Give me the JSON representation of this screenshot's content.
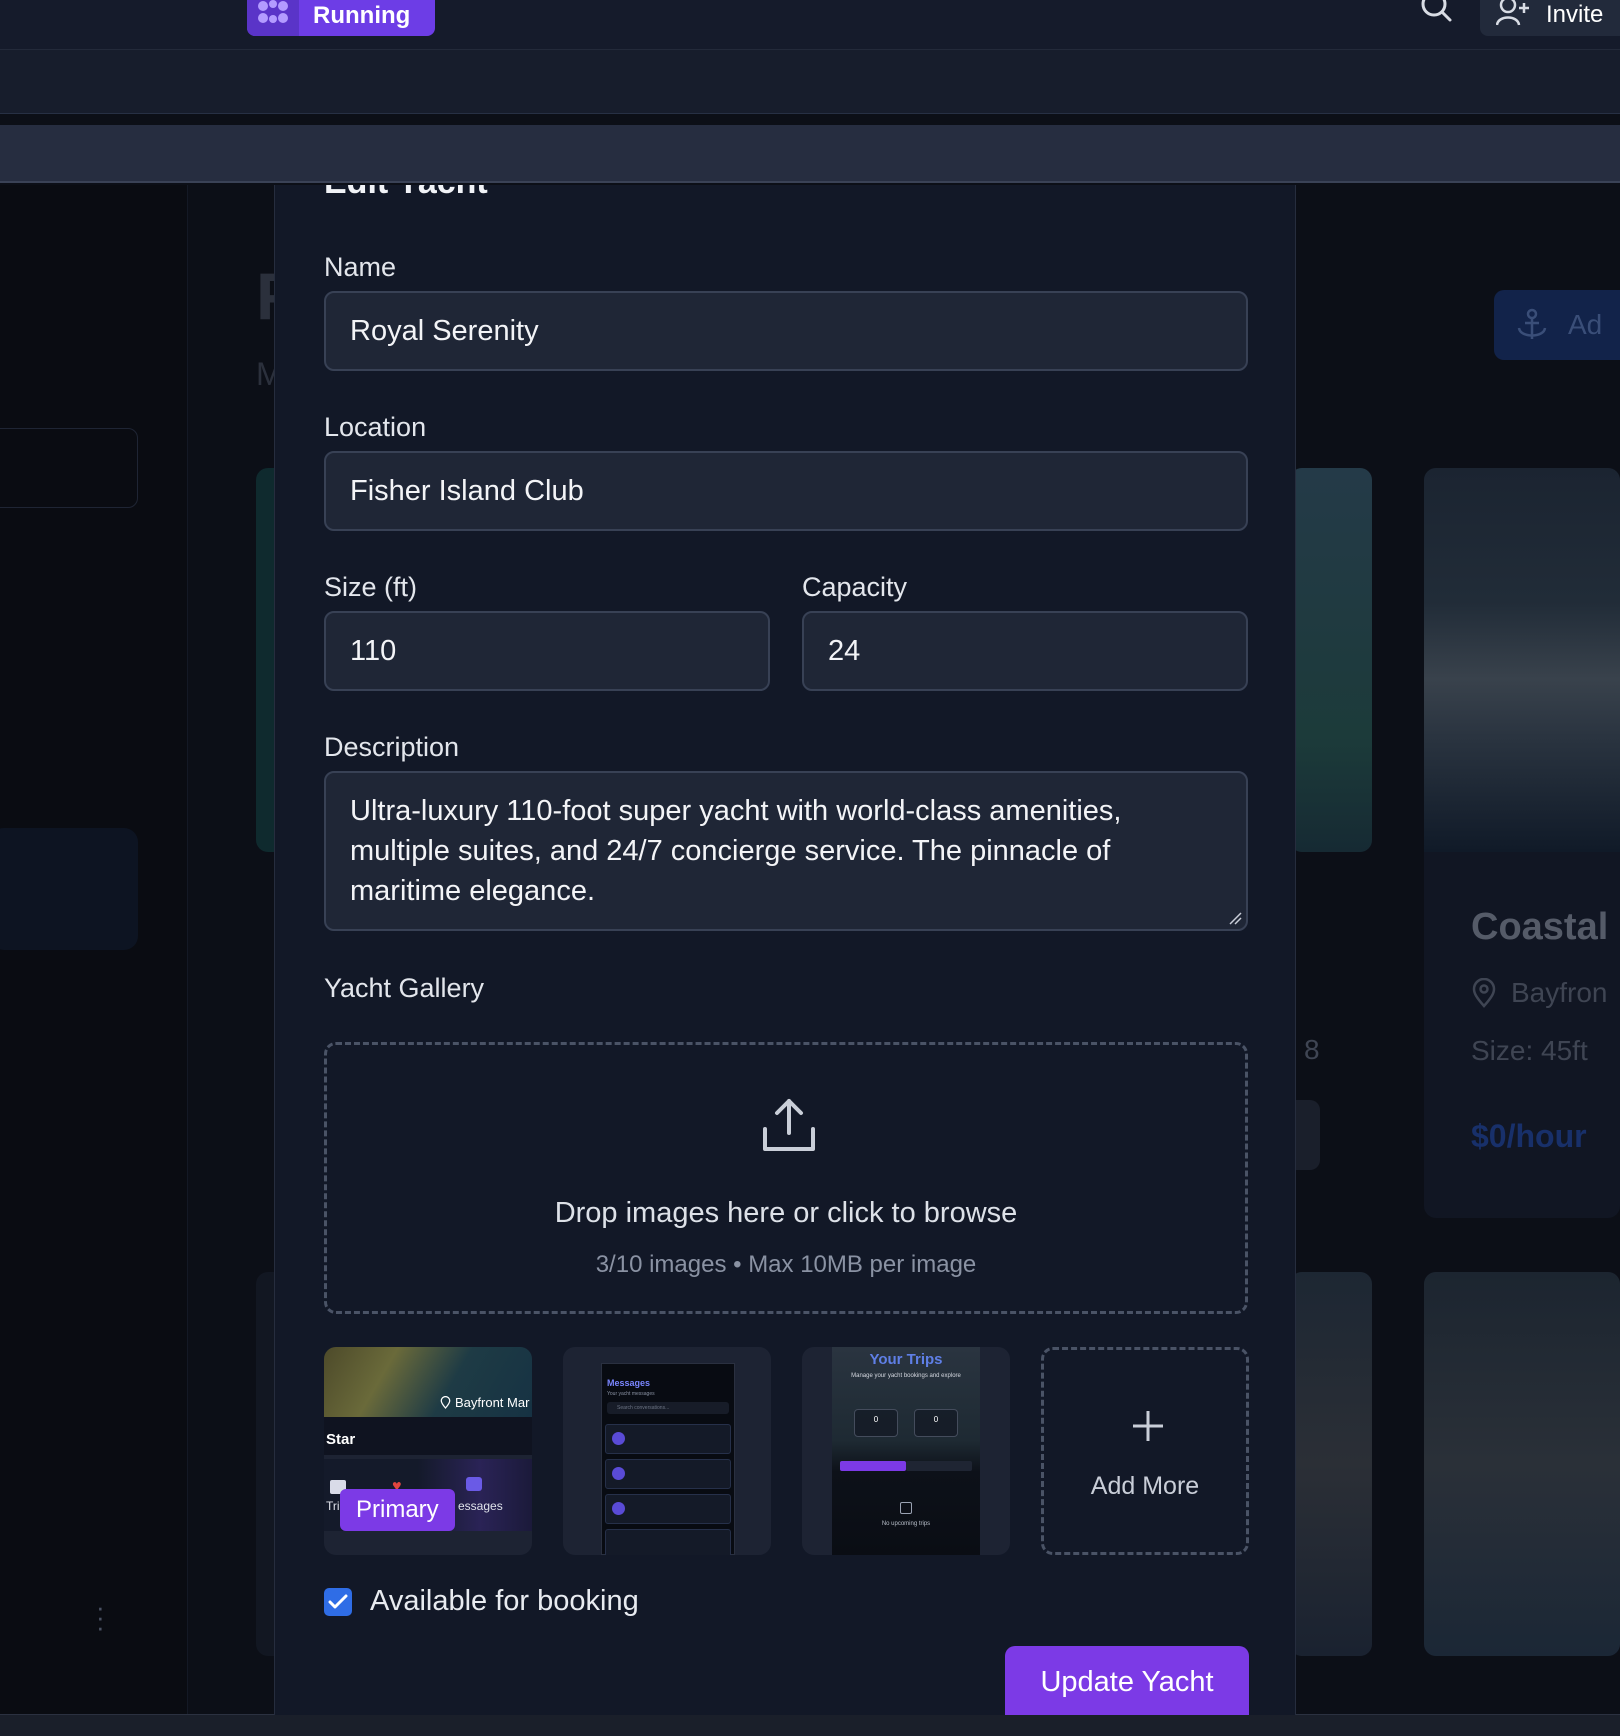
{
  "topbar": {
    "status_label": "Running",
    "invite_label": "Invite"
  },
  "background": {
    "page_title_initial": "F",
    "subtitle_initial": "M",
    "add_button_label": "Ad",
    "card": {
      "title": "Coastal",
      "location": "Bayfron",
      "size": "Size: 45ft",
      "price": "$0/hour"
    },
    "other_card_number": "8"
  },
  "modal": {
    "title": "Edit Yacht",
    "name": {
      "label": "Name",
      "value": "Royal Serenity"
    },
    "location": {
      "label": "Location",
      "value": "Fisher Island Club"
    },
    "size": {
      "label": "Size (ft)",
      "value": "110"
    },
    "capacity": {
      "label": "Capacity",
      "value": "24"
    },
    "description": {
      "label": "Description",
      "value": "Ultra-luxury 110-foot super yacht with world-class amenities, multiple suites, and 24/7 concierge service. The pinnacle of maritime elegance."
    },
    "gallery": {
      "label": "Yacht Gallery",
      "dropzone_text": "Drop images here or click to browse",
      "dropzone_hint": "3/10 images • Max 10MB per image",
      "primary_badge": "Primary",
      "add_more_label": "Add More",
      "thumbs": [
        {
          "location_text": "Bayfront Mar",
          "card_title": "Star",
          "tab_left": "Tri",
          "tab_right": "essages"
        },
        {
          "heading": "Messages",
          "subheading": "Your yacht messages",
          "search_placeholder": "Search conversations..."
        },
        {
          "heading": "Your Trips",
          "subheading": "Manage your yacht bookings and explore",
          "stat_a": "0",
          "stat_b": "0",
          "empty": "No upcoming trips"
        }
      ]
    },
    "available": {
      "label": "Available for booking",
      "checked": true
    },
    "submit_label": "Update Yacht"
  },
  "colors": {
    "accent": "#7c3ae6",
    "checkbox": "#2f6de6",
    "modal_bg": "#121827",
    "input_bg": "#1f2636"
  }
}
